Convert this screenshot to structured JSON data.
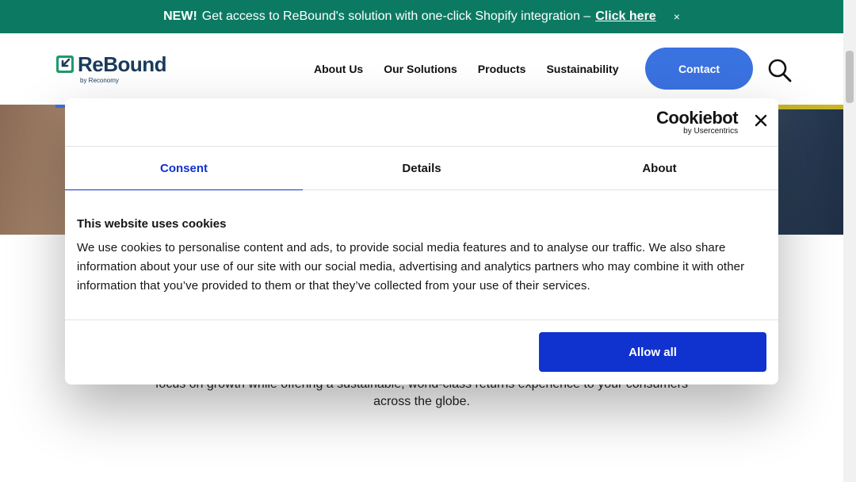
{
  "announcement": {
    "new_label": "NEW!",
    "text": "Get access to ReBound's solution with one-click Shopify integration –",
    "link_label": "Click here",
    "close_glyph": "×",
    "bg_color": "#0c7a63"
  },
  "header": {
    "logo_text": "ReBound",
    "logo_subtext": "by Reconomy",
    "nav_items": [
      "About Us",
      "Our Solutions",
      "Products",
      "Sustainability"
    ],
    "contact_label": "Contact",
    "search_icon": "search-icon",
    "accent_color": "#3a72e0"
  },
  "page": {
    "body_text_line1": "focus on growth while offering a sustainable, world-class returns experience to your consumers",
    "body_text_line2": "across the globe."
  },
  "cookie_modal": {
    "brand_name": "Cookiebot",
    "brand_sub": "by Usercentrics",
    "close_icon": "close-icon",
    "tabs": [
      {
        "label": "Consent",
        "active": true
      },
      {
        "label": "Details",
        "active": false
      },
      {
        "label": "About",
        "active": false
      }
    ],
    "title": "This website uses cookies",
    "description": "We use cookies to personalise content and ads, to provide social media features and to analyse our traffic. We also share information about your use of our site with our social media, advertising and analytics partners who may combine it with other information that you’ve provided to them or that they’ve collected from your use of their services.",
    "allow_all_label": "Allow all",
    "primary_color": "#1032cf"
  }
}
